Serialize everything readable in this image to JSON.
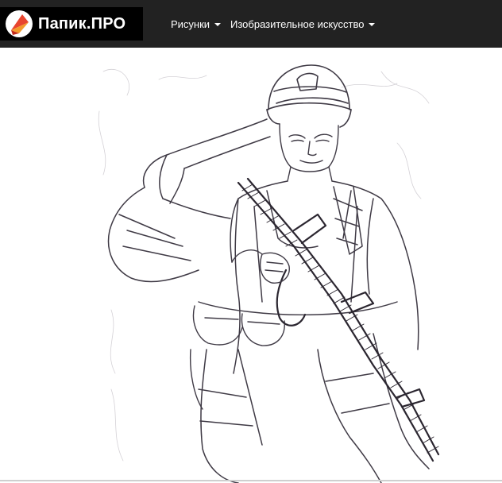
{
  "brand": {
    "name": "Папик.ПРО",
    "logo_icon": "papik-logo-icon",
    "accent": "#e8452f"
  },
  "nav": [
    {
      "label": "Рисунки",
      "dropdown": true
    },
    {
      "label": "Изобразительное искусство",
      "dropdown": true
    }
  ],
  "colors": {
    "topbar": "#222222",
    "brand_bg": "#000000",
    "nav_text": "#ffffff"
  },
  "main": {
    "image_icon": "soldier-sketch-image"
  }
}
